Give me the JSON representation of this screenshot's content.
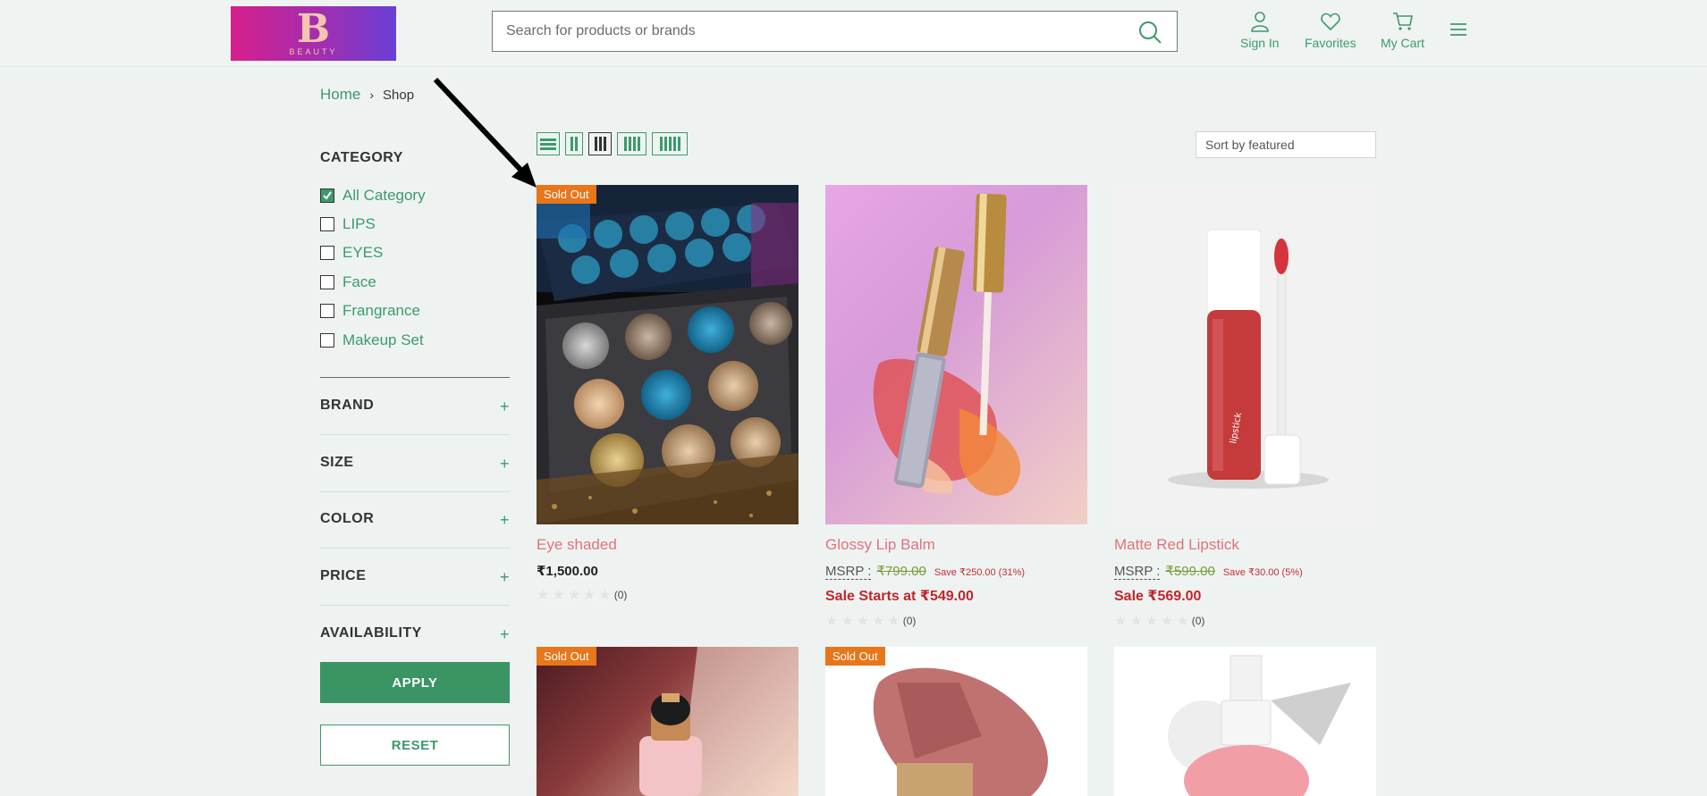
{
  "header": {
    "logo_letter": "B",
    "logo_text": "BEAUTY",
    "search_placeholder": "Search for products or brands",
    "sign_in": "Sign In",
    "favorites": "Favorites",
    "cart": "My Cart"
  },
  "breadcrumb": {
    "home": "Home",
    "current": "Shop"
  },
  "sidebar": {
    "category_title": "CATEGORY",
    "categories": [
      {
        "label": "All Category",
        "checked": true
      },
      {
        "label": "LIPS",
        "checked": false
      },
      {
        "label": "EYES",
        "checked": false
      },
      {
        "label": "Face",
        "checked": false
      },
      {
        "label": "Frangrance",
        "checked": false
      },
      {
        "label": "Makeup Set",
        "checked": false
      }
    ],
    "filters": [
      "BRAND",
      "SIZE",
      "COLOR",
      "PRICE",
      "AVAILABILITY"
    ],
    "apply": "APPLY",
    "reset": "RESET"
  },
  "toolbar": {
    "sort_label": "Sort by featured"
  },
  "products": [
    {
      "name": "Eye shaded",
      "badge": "Sold Out",
      "price": "₹1,500.00",
      "reviews": "(0)"
    },
    {
      "name": "Glossy Lip Balm",
      "msrp_label": "MSRP :",
      "msrp": "₹799.00",
      "save": "Save ₹250.00 (31%)",
      "sale": "Sale Starts at  ₹549.00",
      "reviews": "(0)"
    },
    {
      "name": "Matte Red Lipstick",
      "msrp_label": "MSRP :",
      "msrp": "₹599.00",
      "save": "Save ₹30.00 (5%)",
      "sale": "Sale  ₹569.00",
      "reviews": "(0)"
    },
    {
      "badge": "Sold Out"
    },
    {
      "badge": "Sold Out"
    },
    {}
  ]
}
